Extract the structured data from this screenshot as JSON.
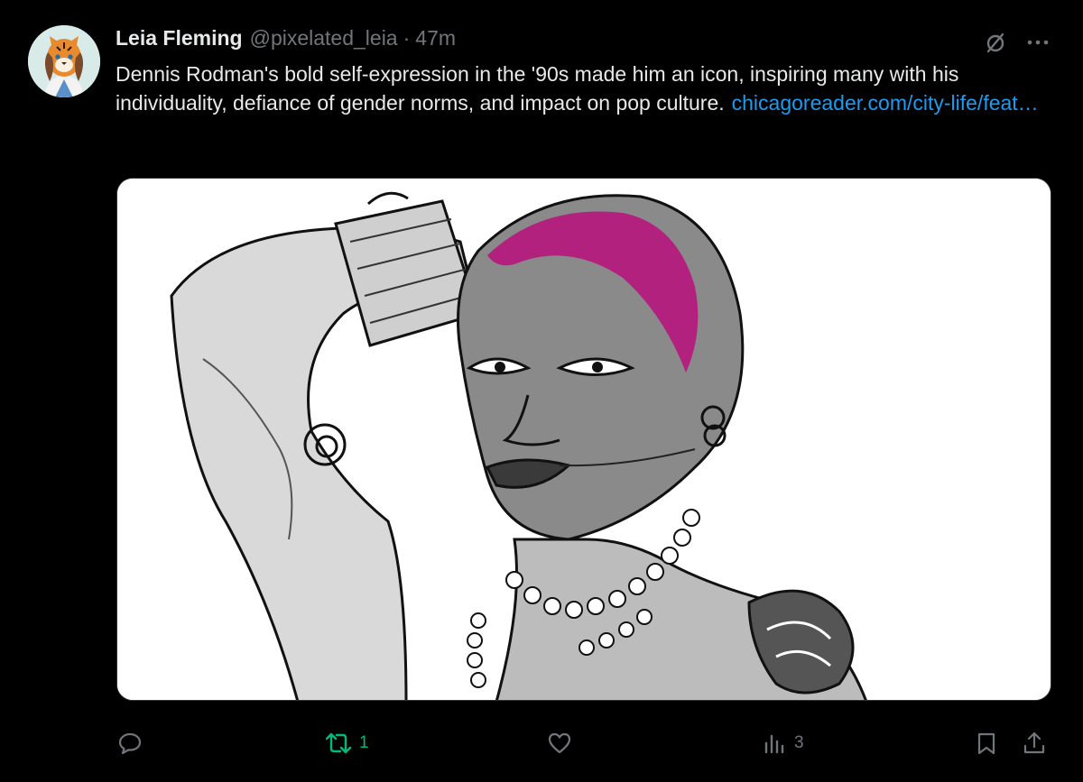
{
  "post": {
    "author": {
      "display_name": "Leia Fleming",
      "handle": "@pixelated_leia",
      "time": "47m"
    },
    "separator": "·",
    "text": "Dennis Rodman's bold self-expression in the '90s made him an icon, inspiring many with his individuality, defiance of gender norms, and impact on pop culture.",
    "link_text": "chicagoreader.com/city-life/feat…",
    "media": {
      "icon": "illustration-image",
      "hair_color": "#b3217f"
    },
    "actions": {
      "reply": {
        "icon": "reply-icon",
        "count": ""
      },
      "repost": {
        "icon": "repost-icon",
        "count": "1"
      },
      "like": {
        "icon": "heart-icon",
        "count": ""
      },
      "views": {
        "icon": "views-icon",
        "count": "3"
      },
      "bookmark": {
        "icon": "bookmark-icon"
      },
      "share": {
        "icon": "share-icon"
      }
    },
    "colors": {
      "background": "#000000",
      "text": "#e7e9ea",
      "muted": "#71767b",
      "link": "#1d9bf0",
      "repost_active": "#00ba7c"
    }
  }
}
